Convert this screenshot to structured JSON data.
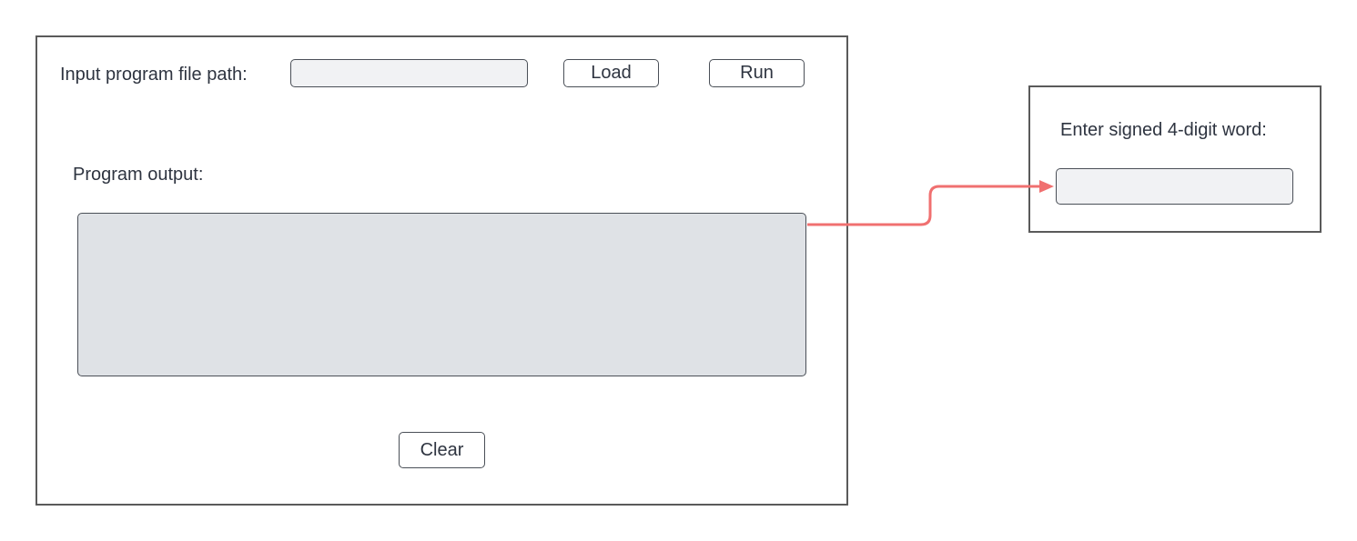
{
  "main_window": {
    "file_path_label": "Input program file path:",
    "file_path_value": "",
    "load_label": "Load",
    "run_label": "Run",
    "output_label": "Program output:",
    "output_text": "",
    "clear_label": "Clear"
  },
  "input_dialog": {
    "prompt_label": "Enter signed 4-digit word:",
    "word_value": ""
  },
  "colors": {
    "connector": "#f07070",
    "field_fill": "#f1f2f4",
    "output_fill": "#dfe2e6",
    "border": "#4a4f57"
  }
}
